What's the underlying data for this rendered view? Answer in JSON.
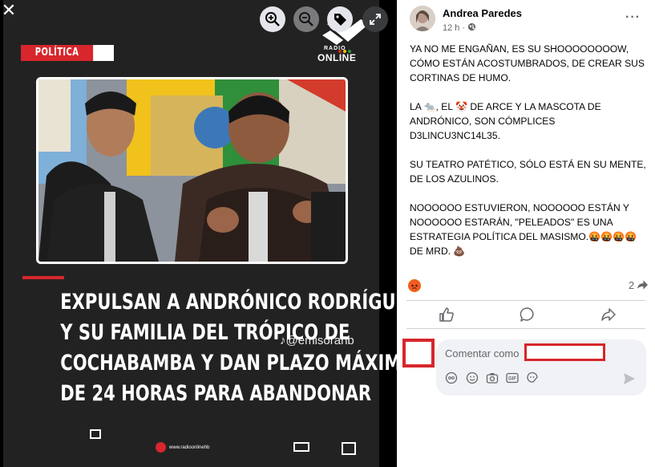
{
  "viewer": {
    "close_glyph": "✕",
    "section_label": "POLÍTICA",
    "brand_small": "RADIO",
    "brand_large": "ONLINE",
    "headline_lines": [
      "EXPULSAN A ANDRÓNICO RODRÍGUEZ",
      "Y SU FAMILIA DEL TRÓPICO DE",
      "COCHABAMBA Y DAN PLAZO MÁXIMO",
      "DE 24 HORAS PARA ABANDONAR"
    ],
    "watermark": "@emisorahb",
    "footer_url": "www.radioonlinehb",
    "icons": [
      "zoom-in-icon",
      "zoom-out-icon",
      "tag-icon",
      "expand-icon"
    ]
  },
  "post": {
    "author": "Andrea Paredes",
    "time": "12 h",
    "paragraphs": [
      "YA NO ME ENGAÑAN, ES SU SHOOOOOOOOW, CÓMO ESTÁN ACOSTUMBRADOS, DE CREAR SUS CORTINAS DE HUMO.",
      "LA 🐀, EL 🤡 DE ARCE Y LA MASCOTA DE ANDRÓNICO, SON CÓMPLICES D3LINCU3NC14L35.",
      "SU TEATRO PATÉTICO, SÓLO ESTÁ EN SU MENTE, DE LOS AZULINOS.",
      "NOOOOOO ESTUVIERON, NOOOOOO ESTÁN Y NOOOOOO ESTARÁN, \"PELEADOS\" ES UNA ESTRATEGIA POLÍTICA DEL MASISMO.🤬🤬🤬🤬 DE MRD. 💩"
    ],
    "share_count": "2",
    "comment_placeholder": "Comentar como"
  },
  "colors": {
    "accent_red": "#d7262c",
    "fb_gray": "#65676b"
  }
}
